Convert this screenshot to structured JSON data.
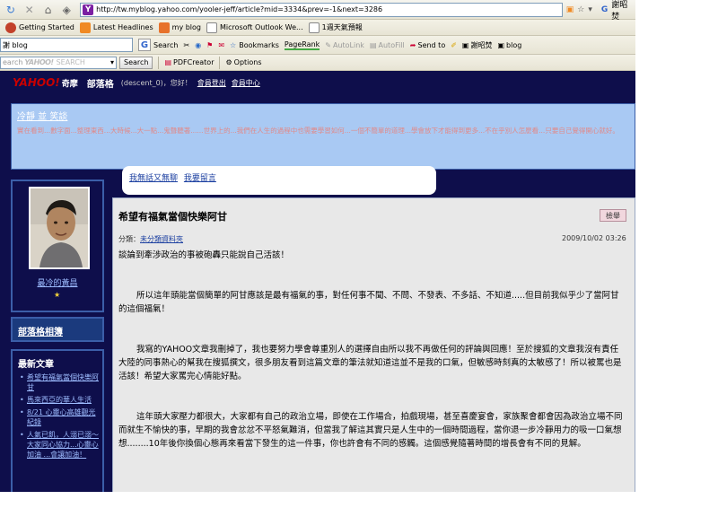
{
  "browser": {
    "url": "http://tw.myblog.yahoo.com/yooler-jeff/article?mid=3334&prev=-1&next=3286",
    "right_label": "謝昭焚"
  },
  "bookmarks_bar": {
    "items": [
      "Getting Started",
      "Latest Headlines",
      "my blog",
      "Microsoft Outlook We...",
      "1週天氣預報"
    ]
  },
  "google_toolbar": {
    "search_value": "謝 blog",
    "search_label": "Search",
    "bookmarks_label": "Bookmarks",
    "pagerank_label": "PageRank",
    "autolink_label": "AutoLink",
    "autofill_label": "AutoFill",
    "sendto_label": "Send to",
    "user_label": "謝昭焚",
    "blog_label": "blog"
  },
  "yahoo_toolbar": {
    "logo": "YAHOO!",
    "input_placeholder": "SEARCH",
    "prefix": "earch",
    "search_label": "Search",
    "pdfcreator_label": "PDFCreator",
    "options_label": "Options"
  },
  "site": {
    "logo": "YAHOO!",
    "logo_sub": "奇摩",
    "name": "部落格",
    "greeting": "(descent_0)，您好！",
    "logout": "會員登出",
    "member_center": "會員中心"
  },
  "banner": {
    "title": "冷靜 並 笑談",
    "text": "實在看到...數字面...整理東西...大時候...大一點...鬼聲聽著......世界上的...我們在人生的過程中也需要學習如何...一個不簡單的道理...學會放下才能得到更多...不在乎別人怎麼看...只要自己覺得開心就好。"
  },
  "comment_bubble": {
    "text": "我無話又無聊",
    "link": "我要留言"
  },
  "sidebar": {
    "profile_name": "最冷的黃昌",
    "friends_label": "部落格相簿",
    "recent_title": "最新文章",
    "recent_posts": [
      "希望有福氣當個快樂阿甘",
      "馬來西亞的華人生活",
      "8/21 心靈心高雄觀光紀錄",
      "人氣已飢，人溺已溺～大家同心協力...心靈心加油 ...會讓加油！"
    ]
  },
  "article": {
    "title": "希望有福氣當個快樂阿甘",
    "report_label": "檢舉",
    "category_label": "分類：",
    "category_value": "未分類資料夾",
    "date": "2009/10/02 03:26",
    "paragraphs": [
      "談論到牽涉政治的事被砲轟只能說自己活該！",
      "所以這年頭能當個簡單的阿甘應該是最有福氣的事，對任何事不聞、不問、不發表、不多話、不知道.....但目前我似乎少了當阿甘的這個福氣！",
      "我寫的YAHOO文章我刪掉了，我也要努力學會尊重別人的選擇自由所以我不再做任何的評論與回應！至於搜狐的文章我沒有責任大陸的同事熱心的幫我在搜狐撰文，很多朋友看到這篇文章的筆法就知道這並不是我的口氣，但敏感時刻真的太敏感了！所以被罵也是活該！希望大家罵完心情能好點。",
      "這年頭大家壓力都很大，大家都有自己的政治立場，即使在工作場合，拍戲現場，甚至喜慶宴會，家族聚會都會因為政治立場不同而就生不愉快的事，早期的我會忿忿不平怒氣難消，但當我了解這其實只是人生中的一個時間過程，當你退一步冷靜用力的吸一口氣想想........10年後你換個心態再來看當下發生的這一件事，你也許會有不同的感觸。這個感覺隨著時間的增長會有不同的見解。"
    ]
  }
}
